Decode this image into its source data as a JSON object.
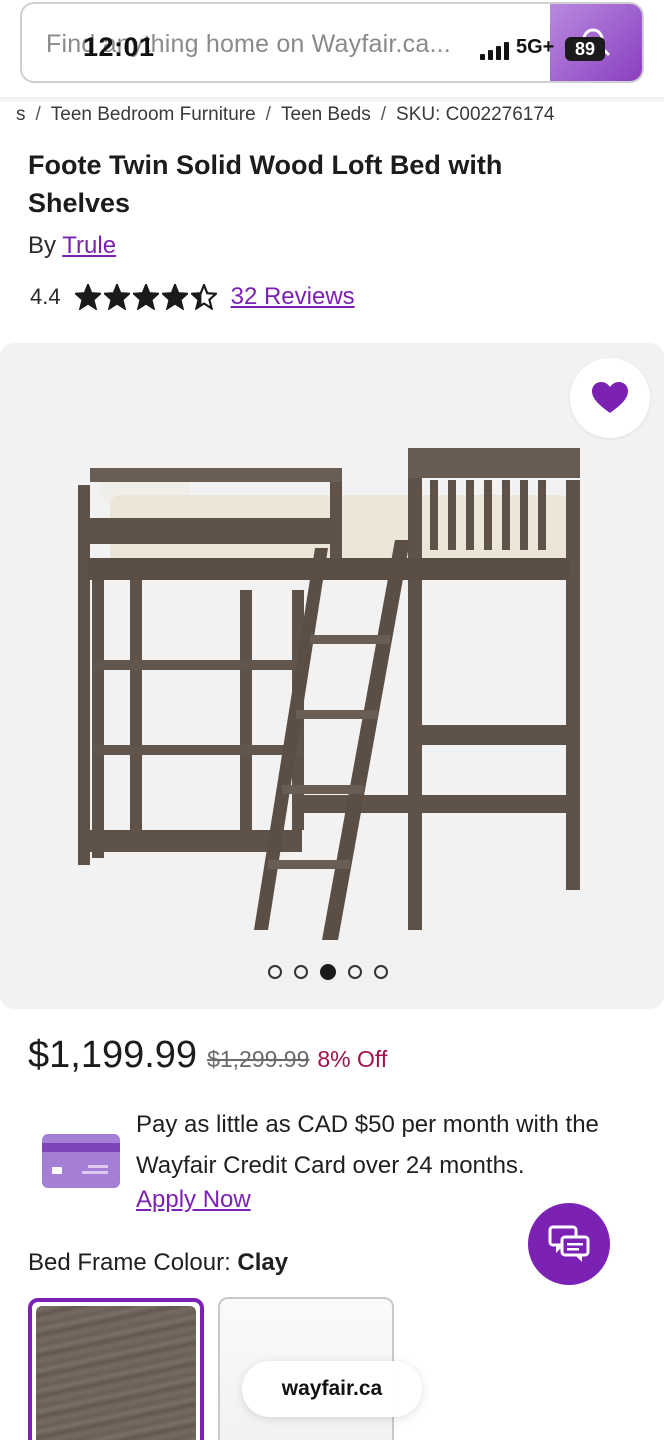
{
  "status_bar": {
    "time": "12:01",
    "network": "5G+",
    "battery": "89"
  },
  "search": {
    "placeholder": "Find anything home on Wayfair.ca..."
  },
  "breadcrumb": [
    "s",
    "Teen Bedroom Furniture",
    "Teen Beds",
    "SKU: C002276174"
  ],
  "product": {
    "title": "Foote Twin Solid Wood Loft Bed with Shelves",
    "by_label": "By",
    "brand": "Trule",
    "rating": "4.4",
    "rating_value": 4.4,
    "rating_max": 5,
    "reviews": "32 Reviews"
  },
  "gallery": {
    "total_images": 5,
    "active_index": 2,
    "favorite_icon": "heart-icon"
  },
  "pricing": {
    "price": "$1,199.99",
    "original_price": "$1,299.99",
    "discount": "8% Off"
  },
  "credit": {
    "text": "Pay as little as CAD $50 per month with the Wayfair Credit Card over 24 months.",
    "link": "Apply Now"
  },
  "options": {
    "colour_label": "Bed Frame Colour:",
    "colour_value": "Clay"
  },
  "footer": {
    "domain": "wayfair.ca"
  },
  "colors": {
    "accent": "#7b22b4",
    "discount": "#a0134d",
    "wood": "#5e5249"
  }
}
